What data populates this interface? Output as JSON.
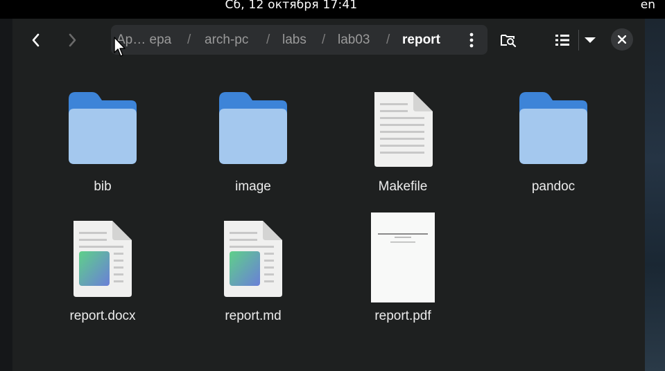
{
  "topbar": {
    "clock": "Сб, 12 октября  17:41",
    "lang": "en"
  },
  "toolbar": {
    "back_icon": "chevron-left-icon",
    "forward_icon": "chevron-right-icon",
    "menu_icon": "vertical-dots-icon",
    "search_icon": "folder-search-icon",
    "view_icon": "list-view-icon",
    "dropdown_icon": "triangle-down-icon",
    "close_icon": "close-icon"
  },
  "breadcrumb": [
    {
      "label": "Ар… ера"
    },
    {
      "label": "arch-pc"
    },
    {
      "label": "labs"
    },
    {
      "label": "lab03"
    },
    {
      "label": "report"
    }
  ],
  "files": [
    {
      "name": "bib",
      "type": "folder"
    },
    {
      "name": "image",
      "type": "folder"
    },
    {
      "name": "Makefile",
      "type": "text"
    },
    {
      "name": "pandoc",
      "type": "folder"
    },
    {
      "name": "report.docx",
      "type": "document"
    },
    {
      "name": "report.md",
      "type": "document"
    },
    {
      "name": "report.pdf",
      "type": "pdf"
    }
  ],
  "colors": {
    "folder_back": "#3d84d8",
    "folder_front": "#a4c8ee",
    "doc_page": "#f0f0ef",
    "accent_background": "#1e2020"
  }
}
